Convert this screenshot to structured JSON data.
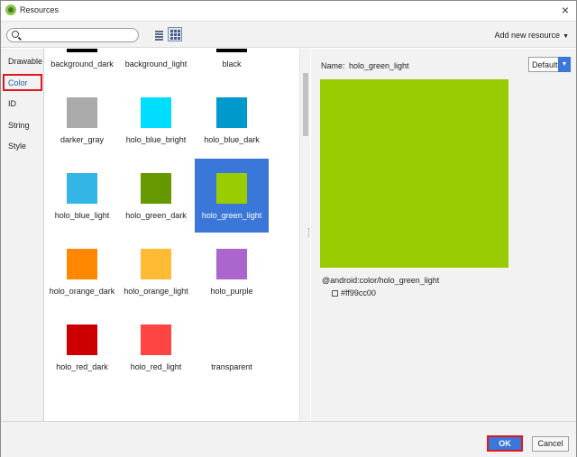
{
  "window": {
    "title": "Resources",
    "close_glyph": "×"
  },
  "toolbar": {
    "search_value": "",
    "search_placeholder": "",
    "add_new_resource": "Add new resource",
    "add_caret": "▼"
  },
  "sidebar": {
    "items": [
      {
        "label": "Drawable"
      },
      {
        "label": "Color"
      },
      {
        "label": "ID"
      },
      {
        "label": "String"
      },
      {
        "label": "Style"
      }
    ],
    "selected": "Color"
  },
  "grid": {
    "items": [
      {
        "name": "background_dark",
        "color": "#000000"
      },
      {
        "name": "background_light",
        "color": "#ffffff"
      },
      {
        "name": "black",
        "color": "#000000"
      },
      {
        "name": "darker_gray",
        "color": "#aaaaaa"
      },
      {
        "name": "holo_blue_bright",
        "color": "#00ddff"
      },
      {
        "name": "holo_blue_dark",
        "color": "#0099cc"
      },
      {
        "name": "holo_blue_light",
        "color": "#33b5e5"
      },
      {
        "name": "holo_green_dark",
        "color": "#669900"
      },
      {
        "name": "holo_green_light",
        "color": "#99cc00"
      },
      {
        "name": "holo_orange_dark",
        "color": "#ff8800"
      },
      {
        "name": "holo_orange_light",
        "color": "#ffbb33"
      },
      {
        "name": "holo_purple",
        "color": "#aa66cc"
      },
      {
        "name": "holo_red_dark",
        "color": "#cc0000"
      },
      {
        "name": "holo_red_light",
        "color": "#ff4444"
      },
      {
        "name": "transparent",
        "color": "transparent"
      }
    ],
    "selected": "holo_green_light"
  },
  "detail": {
    "name_label": "Name:",
    "name_value": "holo_green_light",
    "theme_select": "Default",
    "theme_caret": "▼",
    "preview_color": "#99cc00",
    "resource_path": "@android:color/holo_green_light",
    "resource_value": "#ff99cc00"
  },
  "footer": {
    "ok_label": "OK",
    "cancel_label": "Cancel"
  }
}
